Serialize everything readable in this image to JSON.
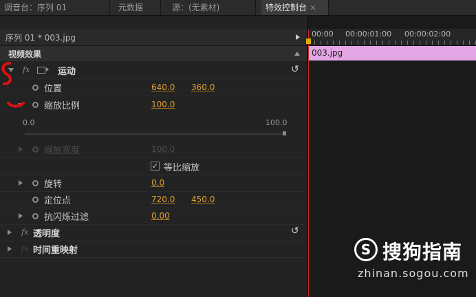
{
  "tabs": [
    {
      "label": "调音台：序列 01",
      "active": false
    },
    {
      "label": "元数据",
      "active": false
    },
    {
      "label": "源：(无素材)",
      "active": false
    },
    {
      "label": "特效控制台",
      "active": true
    }
  ],
  "tab_close": "×",
  "sequence": {
    "label": "序列 01 * 003.jpg"
  },
  "video_effects_label": "视频效果",
  "fx_label": "fx",
  "motion": {
    "label": "运动"
  },
  "position": {
    "label": "位置",
    "x": "640.0",
    "y": "360.0"
  },
  "scale": {
    "label": "缩放比例",
    "value": "100.0",
    "slider_min": "0.0",
    "slider_max": "100.0",
    "slider_fraction": 1.0
  },
  "scale_width": {
    "label": "缩放宽度",
    "value": "100.0"
  },
  "uniform_scale": {
    "label": "等比缩放",
    "checked": true
  },
  "rotation": {
    "label": "旋转",
    "value": "0.0"
  },
  "anchor": {
    "label": "定位点",
    "x": "720.0",
    "y": "450.0"
  },
  "anti_flicker": {
    "label": "抗闪烁过滤",
    "value": "0.00"
  },
  "opacity": {
    "label": "透明度"
  },
  "time_remap": {
    "label": "时间重映射"
  },
  "timeline": {
    "timecodes": [
      "00:00",
      "00:00:01:00",
      "00:00:02:00"
    ],
    "clip_label": "003.jpg"
  },
  "watermark": {
    "logo": "S",
    "text": "搜狗指南",
    "url": "zhinan.sogou.com"
  },
  "colors": {
    "value": "#e0a030",
    "clip": "#e4a6e4",
    "playhead": "#cc3030",
    "annotation": "#e01010"
  }
}
